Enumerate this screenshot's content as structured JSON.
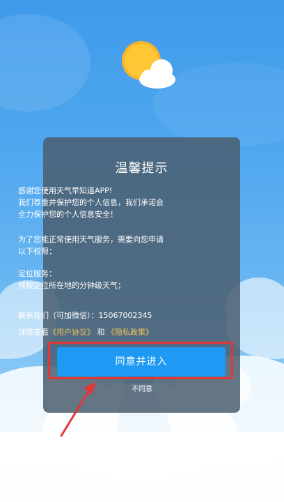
{
  "dialog": {
    "title": "温馨提示",
    "intro_lines": [
      "感谢您使用天气早知道APP!",
      "我们尊重并保护您的个人信息，我们承诺会",
      "全力保护您的个人信息安全！"
    ],
    "permission_lines": [
      "为了您能正常使用天气服务，需要向您申请",
      "以下权限："
    ],
    "service_lines": [
      "定位服务：",
      "预报定位所在地的分钟级天气；"
    ],
    "contact_text": "联系我们（可加微信）：15067002345",
    "details_prefix": "详情查看",
    "user_agreement_link": "《用户协议》",
    "and_text": "和",
    "privacy_policy_link": "《隐私政策》",
    "agree_button": "同意并进入",
    "disagree_button": "不同意"
  },
  "colors": {
    "sky_top": "#3f9bea",
    "dialog_bg": "#4a5e70",
    "primary_button": "#1e9af5",
    "link": "#f6c453",
    "highlight": "#e53636"
  },
  "icons": {
    "weather": "sun-behind-cloud-icon"
  }
}
